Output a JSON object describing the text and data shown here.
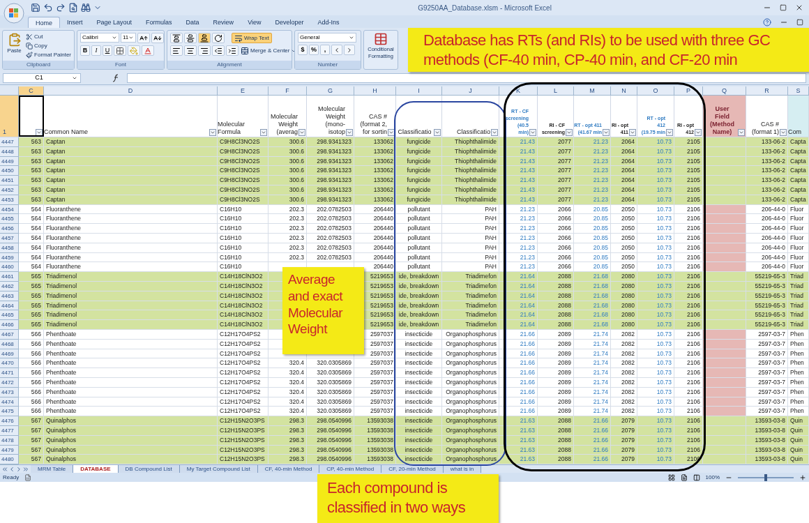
{
  "window": {
    "title": "G9250AA_Database.xlsm - Microsoft Excel"
  },
  "ribbon_tabs": [
    {
      "label": "Home",
      "selected": true
    },
    {
      "label": "Insert",
      "selected": false
    },
    {
      "label": "Page Layout",
      "selected": false
    },
    {
      "label": "Formulas",
      "selected": false
    },
    {
      "label": "Data",
      "selected": false
    },
    {
      "label": "Review",
      "selected": false
    },
    {
      "label": "View",
      "selected": false
    },
    {
      "label": "Developer",
      "selected": false
    },
    {
      "label": "Add-Ins",
      "selected": false
    }
  ],
  "clipboard": {
    "paste": "Paste",
    "cut": "Cut",
    "copy": "Copy",
    "format_painter": "Format Painter",
    "label": "Clipboard"
  },
  "font": {
    "name": "Calibri",
    "size": "11",
    "style_buttons": [
      "B",
      "I",
      "U"
    ],
    "label": "Font"
  },
  "alignment": {
    "wrap_text": {
      "label": "Wrap Text",
      "on": true
    },
    "merge": "Merge & Center",
    "label": "Alignment"
  },
  "number": {
    "format": "General",
    "buttons": [
      "$",
      "%",
      ","
    ],
    "label": "Number"
  },
  "conditional_formatting": "Conditional\nFormatting",
  "name_box": "C1",
  "columns": [
    {
      "letter": "C",
      "kind": "plain",
      "selected": true
    },
    {
      "letter": "D",
      "text": "Common Name",
      "kind": "plain",
      "selected": false
    },
    {
      "letter": "E",
      "text": "Molecular\nFormula",
      "kind": "plain",
      "selected": false
    },
    {
      "letter": "F",
      "text": "Molecular\nWeight\n(averag",
      "kind": "plain",
      "selected": false
    },
    {
      "letter": "G",
      "text": "Molecular\nWeight\n(mono-\nisotop",
      "kind": "plain",
      "selected": false
    },
    {
      "letter": "H",
      "text": "CAS #\n(format 2,\nfor sortin",
      "kind": "plain",
      "selected": false
    },
    {
      "letter": "I",
      "text": "Classificatio",
      "kind": "plain",
      "selected": false
    },
    {
      "letter": "J",
      "text": "Classificatio",
      "kind": "plain",
      "selected": false
    },
    {
      "letter": "K",
      "text": "RT - CF\nscreening (40.5\nmin)",
      "kind": "rt",
      "selected": false
    },
    {
      "letter": "L",
      "text": "RI - CF\nscreening",
      "kind": "ri",
      "selected": false
    },
    {
      "letter": "M",
      "text": "RT - opt 411\n(41.67 min",
      "kind": "rt",
      "selected": false
    },
    {
      "letter": "N",
      "text": "RI - opt\n411",
      "kind": "ri",
      "selected": false
    },
    {
      "letter": "O",
      "text": "RT - opt 412\n(19.75 min",
      "kind": "rt",
      "selected": false
    },
    {
      "letter": "P",
      "text": "RI - opt\n412",
      "kind": "ri",
      "selected": false
    },
    {
      "letter": "Q",
      "text": "User Field\n(Method\nName)",
      "kind": "user",
      "selected": false
    },
    {
      "letter": "R",
      "text": "CAS #\n(format 1)",
      "kind": "plain",
      "selected": false
    },
    {
      "letter": "S",
      "text": "Com",
      "kind": "note",
      "selected": false
    }
  ],
  "header_row": {
    "number": "1",
    "selected": true
  },
  "rows": [
    {
      "number": "4447",
      "highlight": true,
      "C": "563",
      "D": "Captan",
      "E": "C9H8Cl3NO2S",
      "F": "300.6",
      "G": "298.9341323",
      "H": "133062",
      "I": "fungicide",
      "J": "Thiophthalimide",
      "K": "21.43",
      "L": "2077",
      "M": "21.23",
      "N": "2064",
      "O": "10.73",
      "P": "2105",
      "R": "133-06-2",
      "S": "Capta"
    },
    {
      "number": "4448",
      "highlight": true,
      "C": "563",
      "D": "Captan",
      "E": "C9H8Cl3NO2S",
      "F": "300.6",
      "G": "298.9341323",
      "H": "133062",
      "I": "fungicide",
      "J": "Thiophthalimide",
      "K": "21.43",
      "L": "2077",
      "M": "21.23",
      "N": "2064",
      "O": "10.73",
      "P": "2105",
      "R": "133-06-2",
      "S": "Capta"
    },
    {
      "number": "4449",
      "highlight": true,
      "C": "563",
      "D": "Captan",
      "E": "C9H8Cl3NO2S",
      "F": "300.6",
      "G": "298.9341323",
      "H": "133062",
      "I": "fungicide",
      "J": "Thiophthalimide",
      "K": "21.43",
      "L": "2077",
      "M": "21.23",
      "N": "2064",
      "O": "10.73",
      "P": "2105",
      "R": "133-06-2",
      "S": "Capta"
    },
    {
      "number": "4450",
      "highlight": true,
      "C": "563",
      "D": "Captan",
      "E": "C9H8Cl3NO2S",
      "F": "300.6",
      "G": "298.9341323",
      "H": "133062",
      "I": "fungicide",
      "J": "Thiophthalimide",
      "K": "21.43",
      "L": "2077",
      "M": "21.23",
      "N": "2064",
      "O": "10.73",
      "P": "2105",
      "R": "133-06-2",
      "S": "Capta"
    },
    {
      "number": "4451",
      "highlight": true,
      "C": "563",
      "D": "Captan",
      "E": "C9H8Cl3NO2S",
      "F": "300.6",
      "G": "298.9341323",
      "H": "133062",
      "I": "fungicide",
      "J": "Thiophthalimide",
      "K": "21.43",
      "L": "2077",
      "M": "21.23",
      "N": "2064",
      "O": "10.73",
      "P": "2105",
      "R": "133-06-2",
      "S": "Capta"
    },
    {
      "number": "4452",
      "highlight": true,
      "C": "563",
      "D": "Captan",
      "E": "C9H8Cl3NO2S",
      "F": "300.6",
      "G": "298.9341323",
      "H": "133062",
      "I": "fungicide",
      "J": "Thiophthalimide",
      "K": "21.43",
      "L": "2077",
      "M": "21.23",
      "N": "2064",
      "O": "10.73",
      "P": "2105",
      "R": "133-06-2",
      "S": "Capta"
    },
    {
      "number": "4453",
      "highlight": true,
      "C": "563",
      "D": "Captan",
      "E": "C9H8Cl3NO2S",
      "F": "300.6",
      "G": "298.9341323",
      "H": "133062",
      "I": "fungicide",
      "J": "Thiophthalimide",
      "K": "21.43",
      "L": "2077",
      "M": "21.23",
      "N": "2064",
      "O": "10.73",
      "P": "2105",
      "R": "133-06-2",
      "S": "Capta"
    },
    {
      "number": "4454",
      "highlight": false,
      "C": "564",
      "D": "Fluoranthene",
      "E": "C16H10",
      "F": "202.3",
      "G": "202.0782503",
      "H": "206440",
      "I": "pollutant",
      "J": "PAH",
      "K": "21.23",
      "L": "2066",
      "M": "20.85",
      "N": "2050",
      "O": "10.73",
      "P": "2106",
      "R": "206-44-0",
      "S": "Fluor"
    },
    {
      "number": "4455",
      "highlight": false,
      "C": "564",
      "D": "Fluoranthene",
      "E": "C16H10",
      "F": "202.3",
      "G": "202.0782503",
      "H": "206440",
      "I": "pollutant",
      "J": "PAH",
      "K": "21.23",
      "L": "2066",
      "M": "20.85",
      "N": "2050",
      "O": "10.73",
      "P": "2106",
      "R": "206-44-0",
      "S": "Fluor"
    },
    {
      "number": "4456",
      "highlight": false,
      "C": "564",
      "D": "Fluoranthene",
      "E": "C16H10",
      "F": "202.3",
      "G": "202.0782503",
      "H": "206440",
      "I": "pollutant",
      "J": "PAH",
      "K": "21.23",
      "L": "2066",
      "M": "20.85",
      "N": "2050",
      "O": "10.73",
      "P": "2106",
      "R": "206-44-0",
      "S": "Fluor"
    },
    {
      "number": "4457",
      "highlight": false,
      "C": "564",
      "D": "Fluoranthene",
      "E": "C16H10",
      "F": "202.3",
      "G": "202.0782503",
      "H": "206440",
      "I": "pollutant",
      "J": "PAH",
      "K": "21.23",
      "L": "2066",
      "M": "20.85",
      "N": "2050",
      "O": "10.73",
      "P": "2106",
      "R": "206-44-0",
      "S": "Fluor"
    },
    {
      "number": "4458",
      "highlight": false,
      "C": "564",
      "D": "Fluoranthene",
      "E": "C16H10",
      "F": "202.3",
      "G": "202.0782503",
      "H": "206440",
      "I": "pollutant",
      "J": "PAH",
      "K": "21.23",
      "L": "2066",
      "M": "20.85",
      "N": "2050",
      "O": "10.73",
      "P": "2106",
      "R": "206-44-0",
      "S": "Fluor"
    },
    {
      "number": "4459",
      "highlight": false,
      "C": "564",
      "D": "Fluoranthene",
      "E": "C16H10",
      "F": "202.3",
      "G": "202.0782503",
      "H": "206440",
      "I": "pollutant",
      "J": "PAH",
      "K": "21.23",
      "L": "2066",
      "M": "20.85",
      "N": "2050",
      "O": "10.73",
      "P": "2106",
      "R": "206-44-0",
      "S": "Fluor"
    },
    {
      "number": "4460",
      "highlight": false,
      "C": "564",
      "D": "Fluoranthene",
      "E": "C16H10",
      "H": "206440",
      "I": "pollutant",
      "J": "PAH",
      "K": "21.23",
      "L": "2066",
      "M": "20.85",
      "N": "2050",
      "O": "10.73",
      "P": "2106",
      "R": "206-44-0",
      "S": "Fluor"
    },
    {
      "number": "4461",
      "highlight": true,
      "C": "565",
      "D": "Triadimenol",
      "E": "C14H18ClN3O2",
      "H": "5219653",
      "I": "ide, breakdown",
      "J": "Triadimefon",
      "K": "21.64",
      "L": "2088",
      "M": "21.68",
      "N": "2080",
      "O": "10.73",
      "P": "2106",
      "R": "55219-65-3",
      "S": "Triad"
    },
    {
      "number": "4462",
      "highlight": true,
      "C": "565",
      "D": "Triadimenol",
      "E": "C14H18ClN3O2",
      "H": "5219653",
      "I": "ide, breakdown",
      "J": "Triadimefon",
      "K": "21.64",
      "L": "2088",
      "M": "21.68",
      "N": "2080",
      "O": "10.73",
      "P": "2106",
      "R": "55219-65-3",
      "S": "Triad"
    },
    {
      "number": "4463",
      "highlight": true,
      "C": "565",
      "D": "Triadimenol",
      "E": "C14H18ClN3O2",
      "H": "5219653",
      "I": "ide, breakdown",
      "J": "Triadimefon",
      "K": "21.64",
      "L": "2088",
      "M": "21.68",
      "N": "2080",
      "O": "10.73",
      "P": "2106",
      "R": "55219-65-3",
      "S": "Triad"
    },
    {
      "number": "4464",
      "highlight": true,
      "C": "565",
      "D": "Triadimenol",
      "E": "C14H18ClN3O2",
      "H": "5219653",
      "I": "ide, breakdown",
      "J": "Triadimefon",
      "K": "21.64",
      "L": "2088",
      "M": "21.68",
      "N": "2080",
      "O": "10.73",
      "P": "2106",
      "R": "55219-65-3",
      "S": "Triad"
    },
    {
      "number": "4465",
      "highlight": true,
      "C": "565",
      "D": "Triadimenol",
      "E": "C14H18ClN3O2",
      "H": "5219653",
      "I": "ide, breakdown",
      "J": "Triadimefon",
      "K": "21.64",
      "L": "2088",
      "M": "21.68",
      "N": "2080",
      "O": "10.73",
      "P": "2106",
      "R": "55219-65-3",
      "S": "Triad"
    },
    {
      "number": "4466",
      "highlight": true,
      "C": "565",
      "D": "Triadimenol",
      "E": "C14H18ClN3O2",
      "H": "5219653",
      "I": "ide, breakdown",
      "J": "Triadimefon",
      "K": "21.64",
      "L": "2088",
      "M": "21.68",
      "N": "2080",
      "O": "10.73",
      "P": "2106",
      "R": "55219-65-3",
      "S": "Triad"
    },
    {
      "number": "4467",
      "highlight": false,
      "C": "566",
      "D": "Phenthoate",
      "E": "C12H17O4PS2",
      "H": "2597037",
      "I": "insecticide",
      "J": "Organophosphorus",
      "K": "21.66",
      "L": "2089",
      "M": "21.74",
      "N": "2082",
      "O": "10.73",
      "P": "2106",
      "R": "2597-03-7",
      "S": "Phen"
    },
    {
      "number": "4468",
      "highlight": false,
      "C": "566",
      "D": "Phenthoate",
      "E": "C12H17O4PS2",
      "H": "2597037",
      "I": "insecticide",
      "J": "Organophosphorus",
      "K": "21.66",
      "L": "2089",
      "M": "21.74",
      "N": "2082",
      "O": "10.73",
      "P": "2106",
      "R": "2597-03-7",
      "S": "Phen"
    },
    {
      "number": "4469",
      "highlight": false,
      "C": "566",
      "D": "Phenthoate",
      "E": "C12H17O4PS2",
      "H": "2597037",
      "I": "insecticide",
      "J": "Organophosphorus",
      "K": "21.66",
      "L": "2089",
      "M": "21.74",
      "N": "2082",
      "O": "10.73",
      "P": "2106",
      "R": "2597-03-7",
      "S": "Phen"
    },
    {
      "number": "4470",
      "highlight": false,
      "C": "566",
      "D": "Phenthoate",
      "E": "C12H17O4PS2",
      "F": "320.4",
      "G": "320.0305869",
      "H": "2597037",
      "I": "insecticide",
      "J": "Organophosphorus",
      "K": "21.66",
      "L": "2089",
      "M": "21.74",
      "N": "2082",
      "O": "10.73",
      "P": "2106",
      "R": "2597-03-7",
      "S": "Phen"
    },
    {
      "number": "4471",
      "highlight": false,
      "C": "566",
      "D": "Phenthoate",
      "E": "C12H17O4PS2",
      "F": "320.4",
      "G": "320.0305869",
      "H": "2597037",
      "I": "insecticide",
      "J": "Organophosphorus",
      "K": "21.66",
      "L": "2089",
      "M": "21.74",
      "N": "2082",
      "O": "10.73",
      "P": "2106",
      "R": "2597-03-7",
      "S": "Phen"
    },
    {
      "number": "4472",
      "highlight": false,
      "C": "566",
      "D": "Phenthoate",
      "E": "C12H17O4PS2",
      "F": "320.4",
      "G": "320.0305869",
      "H": "2597037",
      "I": "insecticide",
      "J": "Organophosphorus",
      "K": "21.66",
      "L": "2089",
      "M": "21.74",
      "N": "2082",
      "O": "10.73",
      "P": "2106",
      "R": "2597-03-7",
      "S": "Phen"
    },
    {
      "number": "4473",
      "highlight": false,
      "C": "566",
      "D": "Phenthoate",
      "E": "C12H17O4PS2",
      "F": "320.4",
      "G": "320.0305869",
      "H": "2597037",
      "I": "insecticide",
      "J": "Organophosphorus",
      "K": "21.66",
      "L": "2089",
      "M": "21.74",
      "N": "2082",
      "O": "10.73",
      "P": "2106",
      "R": "2597-03-7",
      "S": "Phen"
    },
    {
      "number": "4474",
      "highlight": false,
      "C": "566",
      "D": "Phenthoate",
      "E": "C12H17O4PS2",
      "F": "320.4",
      "G": "320.0305869",
      "H": "2597037",
      "I": "insecticide",
      "J": "Organophosphorus",
      "K": "21.66",
      "L": "2089",
      "M": "21.74",
      "N": "2082",
      "O": "10.73",
      "P": "2106",
      "R": "2597-03-7",
      "S": "Phen"
    },
    {
      "number": "4475",
      "highlight": false,
      "C": "566",
      "D": "Phenthoate",
      "E": "C12H17O4PS2",
      "F": "320.4",
      "G": "320.0305869",
      "H": "2597037",
      "I": "insecticide",
      "J": "Organophosphorus",
      "K": "21.66",
      "L": "2089",
      "M": "21.74",
      "N": "2082",
      "O": "10.73",
      "P": "2106",
      "R": "2597-03-7",
      "S": "Phen"
    },
    {
      "number": "4476",
      "highlight": true,
      "C": "567",
      "D": "Quinalphos",
      "E": "C12H15N2O3PS",
      "F": "298.3",
      "G": "298.0540996",
      "H": "13593038",
      "I": "insecticide",
      "J": "Organophosphorus",
      "K": "21.63",
      "L": "2088",
      "M": "21.66",
      "N": "2079",
      "O": "10.73",
      "P": "2106",
      "R": "13593-03-8",
      "S": "Quin"
    },
    {
      "number": "4477",
      "highlight": true,
      "C": "567",
      "D": "Quinalphos",
      "E": "C12H15N2O3PS",
      "F": "298.3",
      "G": "298.0540996",
      "H": "13593038",
      "I": "insecticide",
      "J": "Organophosphorus",
      "K": "21.63",
      "L": "2088",
      "M": "21.66",
      "N": "2079",
      "O": "10.73",
      "P": "2106",
      "R": "13593-03-8",
      "S": "Quin"
    },
    {
      "number": "4478",
      "highlight": true,
      "C": "567",
      "D": "Quinalphos",
      "E": "C12H15N2O3PS",
      "F": "298.3",
      "G": "298.0540996",
      "H": "13593038",
      "I": "insecticide",
      "J": "Organophosphorus",
      "K": "21.63",
      "L": "2088",
      "M": "21.66",
      "N": "2079",
      "O": "10.73",
      "P": "2106",
      "R": "13593-03-8",
      "S": "Quin"
    },
    {
      "number": "4479",
      "highlight": true,
      "C": "567",
      "D": "Quinalphos",
      "E": "C12H15N2O3PS",
      "F": "298.3",
      "G": "298.0540996",
      "H": "13593038",
      "I": "insecticide",
      "J": "Organophosphorus",
      "K": "21.63",
      "L": "2088",
      "M": "21.66",
      "N": "2079",
      "O": "10.73",
      "P": "2106",
      "R": "13593-03-8",
      "S": "Quin"
    },
    {
      "number": "4480",
      "highlight": true,
      "C": "567",
      "D": "Quinalphos",
      "E": "C12H15N2O3PS",
      "F": "298.3",
      "G": "298.0540996",
      "H": "13593038",
      "I": "insecticide",
      "J": "Organophosphorus",
      "K": "21.63",
      "L": "2088",
      "M": "21.66",
      "N": "2079",
      "O": "10.73",
      "P": "2106",
      "R": "13593-03-8",
      "S": "Quin"
    }
  ],
  "sheet_tabs": [
    {
      "label": "MRM Table",
      "selected": false
    },
    {
      "label": "DATABASE",
      "selected": true
    },
    {
      "label": "DB Compound List",
      "selected": false
    },
    {
      "label": "My Target Compound List",
      "selected": false
    },
    {
      "label": "CF, 40-min Method",
      "selected": false
    },
    {
      "label": "CP, 40-min Method",
      "selected": false
    },
    {
      "label": "CF, 20-min Method",
      "selected": false
    },
    {
      "label": "what is in",
      "selected": false
    }
  ],
  "status_bar": {
    "mode": "Ready",
    "zoom": "100%",
    "zoom_slider": {
      "level": 0.5
    }
  },
  "callouts": [
    "Database has RTs (and RIs) to be used with three GC methods (CF-40 min, CP-40 min, and CF-20 min",
    "Average and exact Molecular Weight",
    "Each compound is classified in two ways"
  ]
}
